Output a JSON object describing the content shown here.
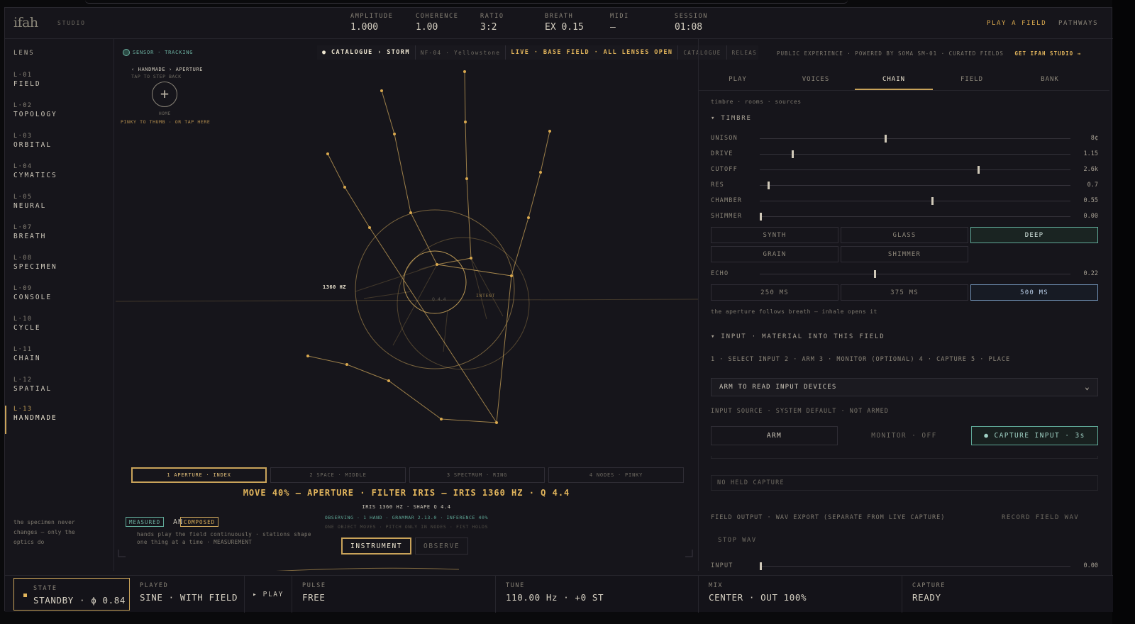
{
  "header": {
    "logo": "ifah",
    "studio": "STUDIO",
    "metrics": [
      {
        "label": "AMPLITUDE",
        "value": "1.000"
      },
      {
        "label": "COHERENCE",
        "value": "1.00"
      },
      {
        "label": "RATIO",
        "value": "3:2"
      },
      {
        "label": "BREATH",
        "value": "EX 0.15"
      },
      {
        "label": "MIDI",
        "value": "—"
      },
      {
        "label": "SESSION",
        "value": "01:08"
      }
    ],
    "play_a_field": "PLAY A FIELD",
    "pathways": "PATHWAYS"
  },
  "lens": {
    "title": "LENS",
    "items": [
      {
        "num": "L·01",
        "name": "FIELD"
      },
      {
        "num": "L·02",
        "name": "TOPOLOGY"
      },
      {
        "num": "L·03",
        "name": "ORBITAL"
      },
      {
        "num": "L·04",
        "name": "CYMATICS"
      },
      {
        "num": "L·05",
        "name": "NEURAL"
      },
      {
        "num": "L·07",
        "name": "BREATH"
      },
      {
        "num": "L·08",
        "name": "SPECIMEN"
      },
      {
        "num": "L·09",
        "name": "CONSOLE"
      },
      {
        "num": "L·10",
        "name": "CYCLE"
      },
      {
        "num": "L·11",
        "name": "CHAIN"
      },
      {
        "num": "L·12",
        "name": "SPATIAL"
      },
      {
        "num": "L·13",
        "name": "HANDMADE"
      }
    ],
    "note": "the specimen never changes — only the optics do"
  },
  "stage": {
    "sensor": "SENSOR · TRACKING",
    "crumb": "‹ HANDMADE › APERTURE",
    "tap_back": "TAP TO STEP BACK",
    "home_symbol": "+",
    "home_label": "HOME",
    "pinky": "PINKY TO THUMB · OR TAP HERE",
    "catalogue_bar": {
      "path": "● CATALOGUE › STORM",
      "code": "NF-04 · Yellowstone",
      "live": "LIVE · BASE FIELD · ALL LENSES OPEN",
      "catalogue": "CATALOGUE",
      "release": "RELEAS"
    },
    "center_hz": "1360 HZ",
    "center_q": "Q 4.4",
    "intent": "INTENT",
    "mode_tabs": [
      "1 APERTURE · INDEX",
      "2 SPACE · MIDDLE",
      "3 SPECTRUM · RING",
      "4 NODES · PINKY"
    ],
    "move_line": "MOVE 40% — APERTURE · FILTER IRIS — IRIS 1360 HZ · Q 4.4",
    "iris_line": "IRIS 1360 HZ · SHAPE Q 4.4",
    "observing": "OBSERVING · 1 HAND · GRAMMAR 2.13.0 · INFERENCE 40%",
    "one_object": "ONE OBJECT MOVES · PITCH ONLY IN NODES · FIST HOLDS",
    "badge_measured": "MEASURED",
    "badge_an": "AN",
    "badge_composed": "COMPOSED",
    "hands_note_1": "hands play the field continuously · stations shape",
    "hands_note_2": "one thing at a time · MEASUREMENT",
    "instrument": "INSTRUMENT",
    "observe": "OBSERVE"
  },
  "panel": {
    "pub_bar": "PUBLIC EXPERIENCE · POWERED BY SOMA SM-01 · CURATED FIELDS",
    "get_studio": "GET IFAH STUDIO →",
    "tabs": [
      "PLAY",
      "VOICES",
      "CHAIN",
      "FIELD",
      "BANK"
    ],
    "subnav": "timbre · rooms · sources",
    "timbre_title": "▾ TIMBRE",
    "sliders": [
      {
        "label": "UNISON",
        "value": "8¢",
        "level": 0.402
      },
      {
        "label": "DRIVE",
        "value": "1.15",
        "level": 0.103
      },
      {
        "label": "CUTOFF",
        "value": "2.6k",
        "level": 0.702
      },
      {
        "label": "RES",
        "value": "0.7",
        "level": 0.025
      },
      {
        "label": "CHAMBER",
        "value": "0.55",
        "level": 0.553
      },
      {
        "label": "SHIMMER",
        "value": "0.00",
        "level": 0.0
      }
    ],
    "voices": [
      "SYNTH",
      "GLASS",
      "DEEP",
      "GRAIN",
      "SHIMMER"
    ],
    "echo": {
      "label": "ECHO",
      "value": "0.22",
      "level": 0.367
    },
    "echo_times": [
      "250 MS",
      "375 MS",
      "500 MS"
    ],
    "aperture_note": "the aperture follows breath — inhale opens it",
    "input_title": "▾ INPUT · MATERIAL INTO THIS FIELD",
    "steps": "1 · SELECT INPUT  2 · ARM  3 · MONITOR (OPTIONAL)  4 · CAPTURE  5 · PLACE",
    "arm_select": "ARM TO READ INPUT DEVICES",
    "input_source": "INPUT SOURCE · SYSTEM DEFAULT · NOT ARMED",
    "arm": "ARM",
    "monitor": "MONITOR · OFF",
    "capture_input": "● CAPTURE INPUT · 3s",
    "no_capture": "NO HELD CAPTURE",
    "field_output": "FIELD OUTPUT · WAV EXPORT (SEPARATE FROM LIVE CAPTURE)",
    "record_wav": "RECORD FIELD WAV",
    "stop_wav": "STOP WAV",
    "input_row": {
      "label": "INPUT",
      "value": "0.00",
      "level": 0.0
    }
  },
  "bottom": {
    "state_label": "STATE",
    "state_value": "STANDBY · ϕ 0.84",
    "played_label": "PLAYED",
    "played_value": "SINE · WITH FIELD",
    "play": "▸ PLAY",
    "pulse_label": "PULSE",
    "pulse_value": "FREE",
    "tune_label": "TUNE",
    "tune_value": "110.00 Hz · +0 ST",
    "mix_label": "MIX",
    "mix_value": "CENTER · OUT 100%",
    "capture_label": "CAPTURE",
    "capture_value": "READY"
  },
  "colors": {
    "gold": "#c9a35a",
    "teal": "#5fa897",
    "blue": "#6f8fb3",
    "bg": "#16151b"
  }
}
